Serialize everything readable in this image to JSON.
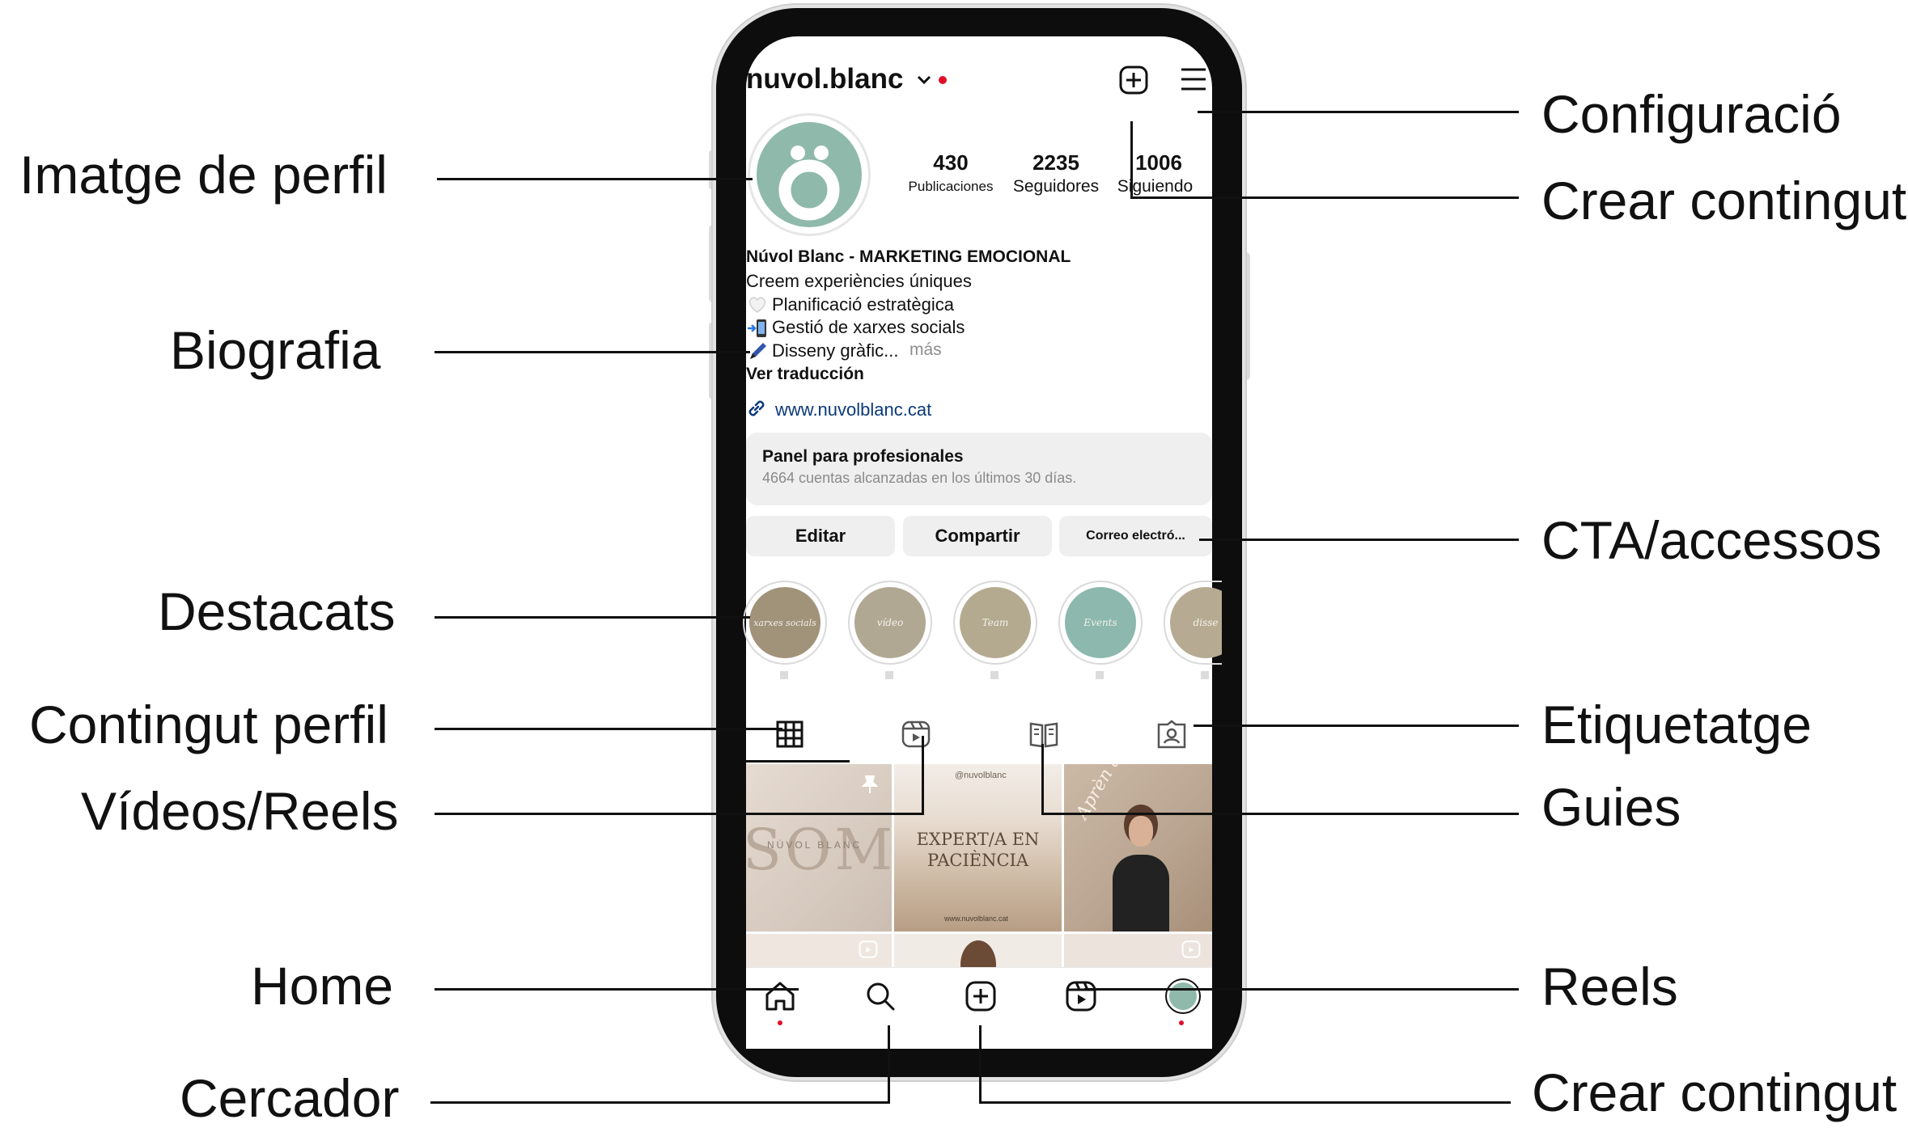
{
  "annotations": {
    "imatge_perfil": "Imatge de perfil",
    "biografia": "Biografia",
    "destacats": "Destacats",
    "contingut_perfil": "Contingut perfil",
    "videos_reels": "Vídeos/Reels",
    "home": "Home",
    "cercador": "Cercador",
    "configuracio": "Configuració",
    "crear_contingut_top": "Crear contingut",
    "cta_accessos": "CTA/accessos",
    "etiquetatge": "Etiquetatge",
    "guies": "Guies",
    "reels": "Reels",
    "crear_contingut_bottom": "Crear contingut"
  },
  "profile": {
    "username": "nuvol.blanc",
    "stats": [
      {
        "value": "430",
        "label": "Publicaciones"
      },
      {
        "value": "2235",
        "label": "Seguidores"
      },
      {
        "value": "1006",
        "label": "Siguiendo"
      }
    ],
    "name_line": "Núvol Blanc - MARKETING EMOCIONAL",
    "bio_lines": [
      "Creem experiències úniques",
      "Planificació estratègica",
      "Gestió de xarxes socials",
      "Disseny gràfic..."
    ],
    "more": "más",
    "translate": "Ver traducción",
    "link": "www.nuvolblanc.cat"
  },
  "pro_panel": {
    "title": "Panel para profesionales",
    "subtitle": "4664 cuentas alcanzadas en los últimos 30 días."
  },
  "actions": {
    "edit": "Editar",
    "share": "Compartir",
    "email": "Correo electró..."
  },
  "highlights": [
    {
      "text": "xarxes socials",
      "color": "#a1927a"
    },
    {
      "text": "vídeo",
      "color": "#b1a893"
    },
    {
      "text": "Team",
      "color": "#b3aa90"
    },
    {
      "text": "Events",
      "color": "#8cb8ad"
    },
    {
      "text": "disse",
      "color": "#b6ab92"
    }
  ],
  "posts": {
    "post1_text": "SOM",
    "post1_brand": "NÚVOL BLANC",
    "post2_handle": "@nuvolblanc",
    "post2_text": "EXPERT/A EN PACIÈNCIA",
    "post2_url": "www.nuvolblanc.cat",
    "post3_text": "Aprèn a fer reels com"
  },
  "colors": {
    "accent_red": "#e0102a",
    "link_blue": "#0b3a7a",
    "avatar_green": "#8fb9ab"
  },
  "icons": [
    "chevron-down-icon",
    "plus-square-icon",
    "menu-icon",
    "link-icon",
    "grid-icon",
    "reels-icon",
    "guide-icon",
    "tag-icon",
    "home-icon",
    "search-icon",
    "create-icon",
    "reels-nav-icon",
    "profile-avatar-icon"
  ]
}
